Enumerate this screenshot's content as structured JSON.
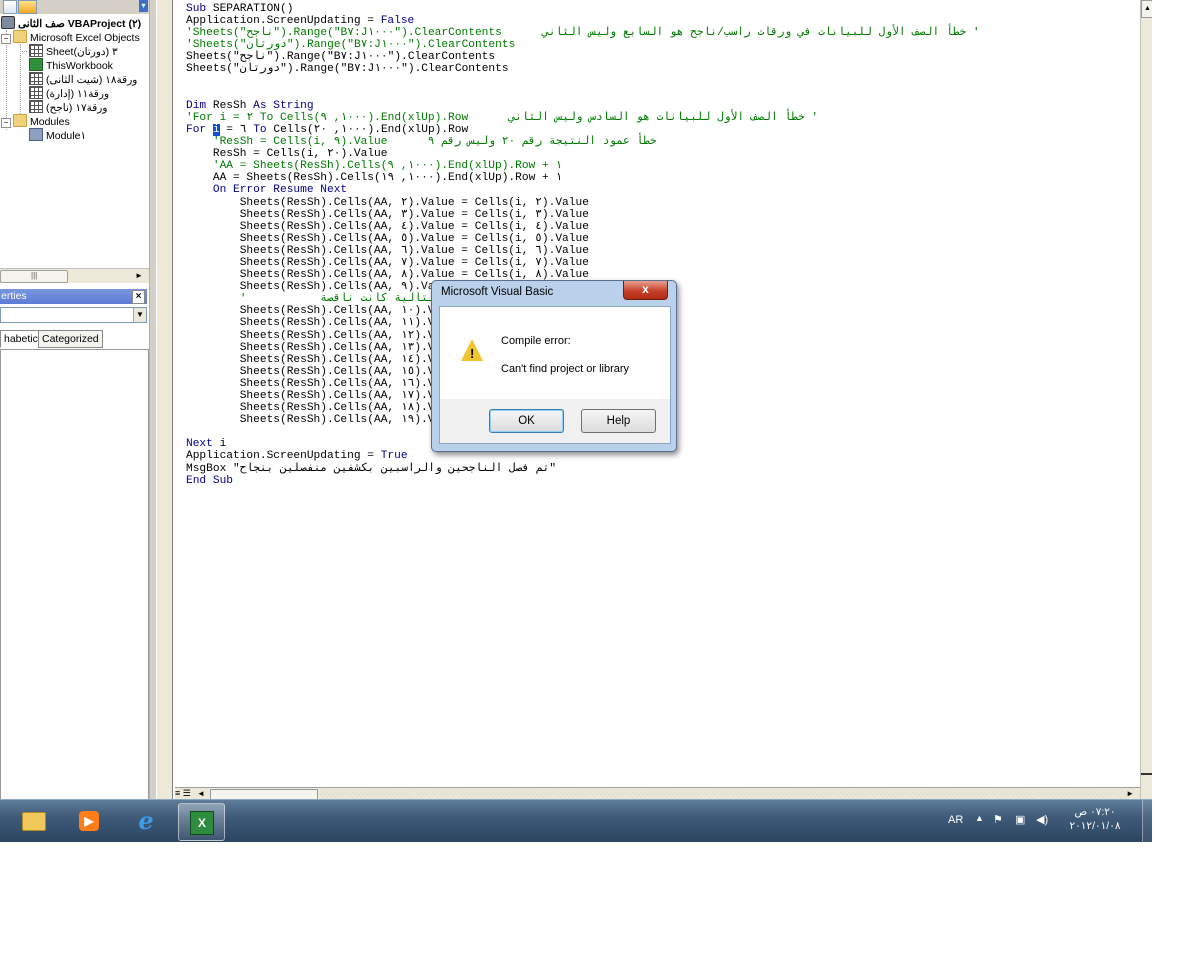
{
  "project_explorer": {
    "title": "صف الثانى VBAProject (٢)",
    "nodes": [
      {
        "label": "Microsoft Excel Objects"
      },
      {
        "label": "Sheet٣ (دورتان)"
      },
      {
        "label": "ThisWorkbook"
      },
      {
        "label": "ورقة١٨ (شيت الثانى)"
      },
      {
        "label": "ورقة١١ (إدارة)"
      },
      {
        "label": "ورقة١٧ (ناجح)"
      },
      {
        "label": "Modules"
      },
      {
        "label": "Module١"
      }
    ]
  },
  "properties": {
    "title": "erties",
    "tabs": [
      "habetic",
      "Categorized"
    ]
  },
  "code": {
    "lines": [
      [
        {
          "t": "Sub",
          "k": "kw"
        },
        {
          "t": " SEPARATION()"
        }
      ],
      [
        {
          "t": "Application.ScreenUpdating = "
        },
        {
          "t": "False",
          "k": "kw"
        }
      ],
      [
        {
          "t": "'Sheets(\"ناجح\").Range(\"B٧:J١٠٠٠\").ClearContents      خطأ الصف الأول للبيانات في ورقات راسب/ناجح هو السابع وليس الثاني '",
          "k": "cm"
        }
      ],
      [
        {
          "t": "'Sheets(\"دورتان\").Range(\"B٧:J١٠٠٠\").ClearContents",
          "k": "cm"
        }
      ],
      [
        {
          "t": "Sheets(\"ناجح\").Range(\"B٧:J١٠٠٠\").ClearContents"
        }
      ],
      [
        {
          "t": "Sheets(\"دورتان\").Range(\"B٧:J١٠٠٠\").ClearContents"
        }
      ],
      [
        {
          "t": ""
        }
      ],
      [
        {
          "t": ""
        }
      ],
      [
        {
          "t": "Dim",
          "k": "kw"
        },
        {
          "t": " ResSh "
        },
        {
          "t": "As String",
          "k": "kw"
        }
      ],
      [
        {
          "t": "'For i = ٢ To Cells(١٠٠٠, ٩).End(xlUp).Row      خطأ الصف الأول للبيانات هو السادس وليس الثاني '",
          "k": "cm"
        }
      ],
      [
        {
          "t": "For",
          "k": "kw"
        },
        {
          "t": " "
        },
        {
          "t": "i",
          "k": "sel"
        },
        {
          "t": " = ٦ "
        },
        {
          "t": "To",
          "k": "kw"
        },
        {
          "t": " Cells(١٠٠٠, ٢٠).End(xlUp).Row"
        }
      ],
      [
        {
          "t": "    'ResSh = Cells(i, ٩).Value      خطأ عمود النتيجة رقم ٢٠ وليس رقم ٩",
          "k": "cm"
        }
      ],
      [
        {
          "t": "    ResSh = Cells(i, ٢٠).Value"
        }
      ],
      [
        {
          "t": "    'AA = Sheets(ResSh).Cells(١٠٠٠, ٩).End(xlUp).Row + ١",
          "k": "cm"
        }
      ],
      [
        {
          "t": "    AA = Sheets(ResSh).Cells(١٠٠٠, ١٩).End(xlUp).Row + ١"
        }
      ],
      [
        {
          "t": "    "
        },
        {
          "t": "On Error Resume Next",
          "k": "kw"
        }
      ],
      [
        {
          "t": "        Sheets(ResSh).Cells(AA, ٢).Value = Cells(i, ٢).Value"
        }
      ],
      [
        {
          "t": "        Sheets(ResSh).Cells(AA, ٣).Value = Cells(i, ٣).Value"
        }
      ],
      [
        {
          "t": "        Sheets(ResSh).Cells(AA, ٤).Value = Cells(i, ٤).Value"
        }
      ],
      [
        {
          "t": "        Sheets(ResSh).Cells(AA, ٥).Value = Cells(i, ٥).Value"
        }
      ],
      [
        {
          "t": "        Sheets(ResSh).Cells(AA, ٦).Value = Cells(i, ٦).Value"
        }
      ],
      [
        {
          "t": "        Sheets(ResSh).Cells(AA, ٧).Value = Cells(i, ٧).Value"
        }
      ],
      [
        {
          "t": "        Sheets(ResSh).Cells(AA, ٨).Value = Cells(i, ٨).Value"
        }
      ],
      [
        {
          "t": "        Sheets(ResSh).Cells(AA, ٩).Value = Cells(i, ٩).Value"
        }
      ],
      [
        {
          "t": "        '           الصفوف التالية كانت ناقصة",
          "k": "cm"
        }
      ],
      [
        {
          "t": "        Sheets(ResSh).Cells(AA, ١٠).Value = Cells(i, ١٠).Value"
        }
      ],
      [
        {
          "t": "        Sheets(ResSh).Cells(AA, ١١).Value = Cells(i, ١١).Value"
        }
      ],
      [
        {
          "t": "        Sheets(ResSh).Cells(AA, ١٢).Value = Cells(i, ١٢).Value"
        }
      ],
      [
        {
          "t": "        Sheets(ResSh).Cells(AA, ١٣).Value = Cells(i, ١٣).Value"
        }
      ],
      [
        {
          "t": "        Sheets(ResSh).Cells(AA, ١٤).Value = Cells(i, ١٤).Value"
        }
      ],
      [
        {
          "t": "        Sheets(ResSh).Cells(AA, ١٥).Value = Cells(i, ١٥).Value"
        }
      ],
      [
        {
          "t": "        Sheets(ResSh).Cells(AA, ١٦).Value = Cells(i, ١٦).Value"
        }
      ],
      [
        {
          "t": "        Sheets(ResSh).Cells(AA, ١٧).Value = Cells(i, ١٧).Value"
        }
      ],
      [
        {
          "t": "        Sheets(ResSh).Cells(AA, ١٨).Value = Cells(i, ١٨).Value"
        }
      ],
      [
        {
          "t": "        Sheets(ResSh).Cells(AA, ١٩).Value = Cells(i, ١٩).Value"
        }
      ],
      [
        {
          "t": ""
        }
      ],
      [
        {
          "t": "Next",
          "k": "kw"
        },
        {
          "t": " i"
        }
      ],
      [
        {
          "t": "Application.ScreenUpdating = "
        },
        {
          "t": "True",
          "k": "kw"
        }
      ],
      [
        {
          "t": "MsgBox \"تم فصل الناجحين والراسبين بكشفين منفصلين بنجاح\""
        }
      ],
      [
        {
          "t": "End Sub",
          "k": "kw"
        }
      ]
    ]
  },
  "dialog": {
    "title": "Microsoft Visual Basic",
    "close_label": "x",
    "line1": "Compile error:",
    "line2": "Can't find project or library",
    "ok_label": "OK",
    "help_label": "Help",
    "icon": "warning-icon"
  },
  "taskbar": {
    "apps": [
      "windows-explorer",
      "windows-media-player",
      "internet-explorer",
      "microsoft-excel"
    ],
    "lang": "AR",
    "time": "٠٧:٢٠ ص",
    "date": "٢٠١٢/٠١/٠٨"
  }
}
